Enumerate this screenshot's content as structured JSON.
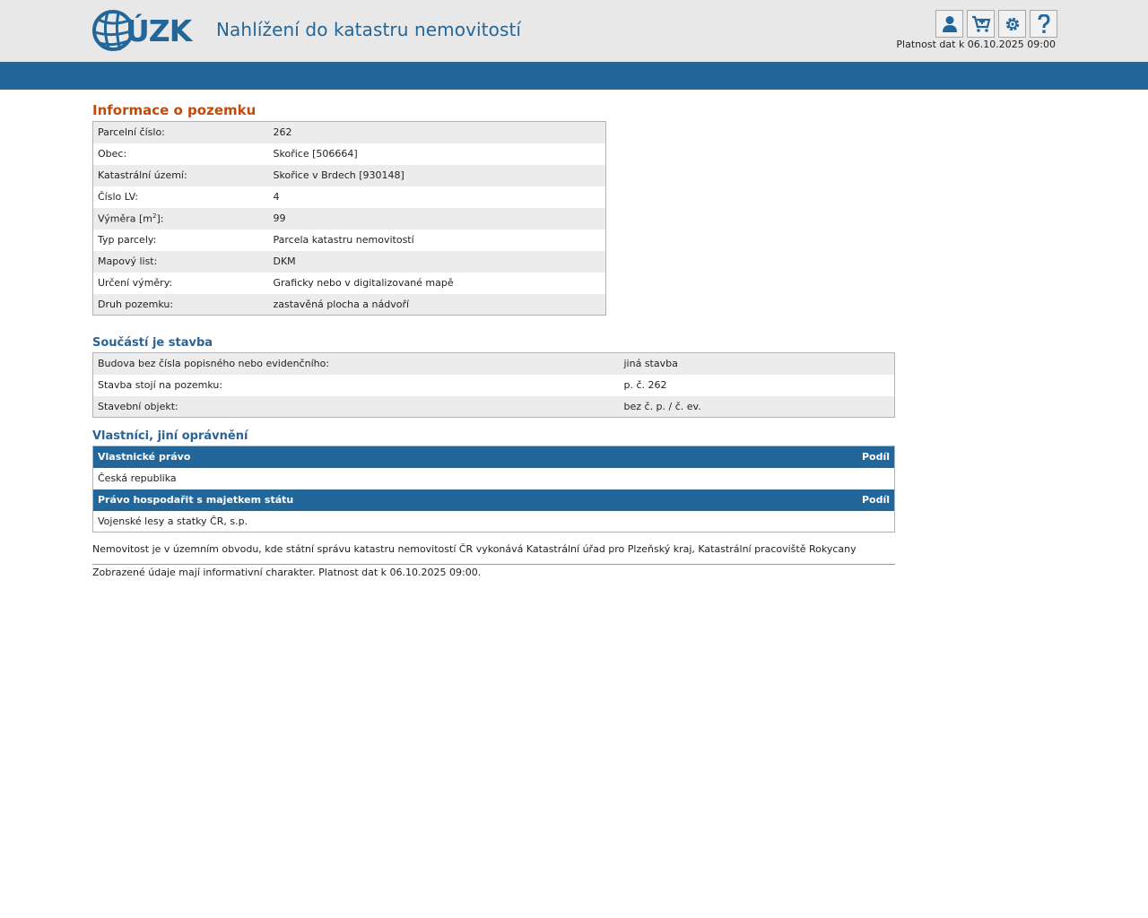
{
  "header": {
    "logo_text": "ÚZK",
    "app_title": "Nahlížení do katastru nemovitostí",
    "validity": "Platnost dat k 06.10.2025 09:00",
    "tools": [
      "user-icon",
      "cart-icon",
      "gear-icon",
      "help-icon"
    ]
  },
  "parcel": {
    "title": "Informace o pozemku",
    "rows": [
      {
        "label": "Parcelní číslo:",
        "value": "262"
      },
      {
        "label": "Obec:",
        "value": "Skořice [506664]"
      },
      {
        "label": "Katastrální území:",
        "value": "Skořice v Brdech [930148]"
      },
      {
        "label": "Číslo LV:",
        "value": "4"
      },
      {
        "label_pre": "Výměra [m",
        "label_sup": "2",
        "label_post": "]:",
        "value": "99"
      },
      {
        "label": "Typ parcely:",
        "value": "Parcela katastru nemovitostí"
      },
      {
        "label": "Mapový list:",
        "value": "DKM"
      },
      {
        "label": "Určení výměry:",
        "value": "Graficky nebo v digitalizované mapě"
      },
      {
        "label": "Druh pozemku:",
        "value": "zastavěná plocha a nádvoří"
      }
    ]
  },
  "building": {
    "title": "Součástí je stavba",
    "rows": [
      {
        "label": "Budova bez čísla popisného nebo evidenčního:",
        "value": "jiná stavba"
      },
      {
        "label": "Stavba stojí na pozemku:",
        "value": "p. č. 262"
      },
      {
        "label": "Stavební objekt:",
        "value": "bez č. p. / č. ev."
      }
    ]
  },
  "owners": {
    "title": "Vlastníci, jiní oprávnění",
    "groups": [
      {
        "header": "Vlastnické právo",
        "share_header": "Podíl",
        "owner": "Česká republika",
        "share": ""
      },
      {
        "header": "Právo hospodařit s majetkem státu",
        "share_header": "Podíl",
        "owner": "Vojenské lesy a statky ČR, s.p.",
        "share": ""
      }
    ]
  },
  "note": "Nemovitost je v územním obvodu, kde státní správu katastru nemovitostí ČR vykonává Katastrální úřad pro Plzeňský kraj, Katastrální pracoviště Rokycany",
  "footer": "Zobrazené údaje mají informativní charakter. Platnost dat k 06.10.2025 09:00.",
  "colors": {
    "brand_blue": "#23669a",
    "heading_orange": "#c04a10"
  }
}
